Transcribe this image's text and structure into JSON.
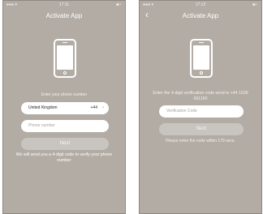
{
  "screen1": {
    "status": {
      "signal": "●●● ▾",
      "time": "17:11",
      "battery": "■□"
    },
    "title": "Activate App",
    "prompt": "Enter your phone number",
    "country": {
      "name": "United Kingdom",
      "code": "+44",
      "chevron": "›"
    },
    "phone_placeholder": "Phone number",
    "next_label": "Next",
    "hint": "We will send you a 4-digit code to verify your phone number"
  },
  "screen2": {
    "status": {
      "signal": "●●● ▾",
      "time": "17:12",
      "battery": "■□"
    },
    "back": "‹",
    "title": "Activate App",
    "prompt": "Enter the 4-digit verification code send to +44 1536 091160",
    "code_placeholder": "Verification Code",
    "next_label": "Next",
    "hint": "Please enter the code within 179 secs."
  }
}
